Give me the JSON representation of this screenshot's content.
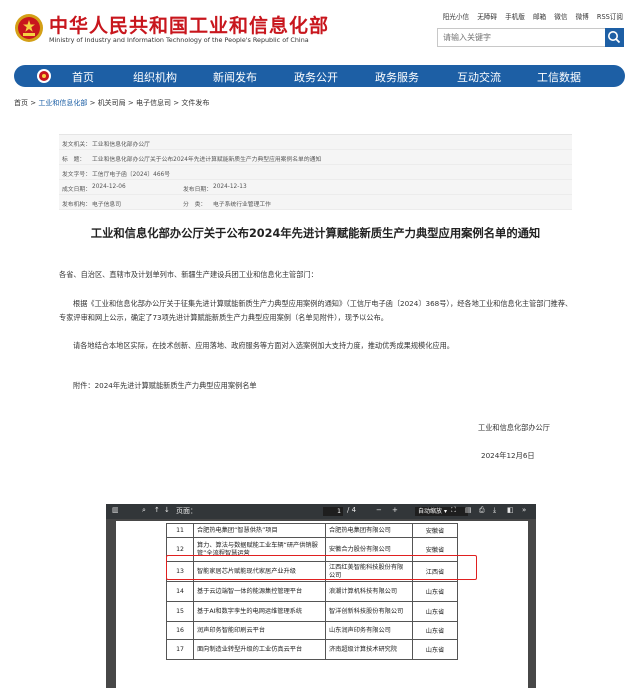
{
  "header": {
    "title": "中华人民共和国工业和信息化部",
    "subtitle": "Ministry of Industry and Information Technology of the People's Republic of China",
    "toplinks": [
      "阳光小信",
      "无障碍",
      "手机版",
      "邮箱",
      "微信",
      "微博",
      "RSS订阅"
    ],
    "search_placeholder": "请输入关键字",
    "brand_color": "#c8161d",
    "accent_color": "#1d5fa5"
  },
  "nav": {
    "items": [
      "首页",
      "组织机构",
      "新闻发布",
      "政务公开",
      "政务服务",
      "互动交流",
      "工信数据"
    ]
  },
  "breadcrumb": {
    "home": "首页",
    "sep": ">",
    "items": [
      "工业和信息化部",
      "机关司局",
      "电子信息司",
      "文件发布"
    ]
  },
  "meta": {
    "issuer_label": "发文机关：",
    "issuer": "工业和信息化部办公厅",
    "title_label": "标　题：",
    "title": "工业和信息化部办公厅关于公布2024年先进计算赋能新质生产力典型应用案例名单的通知",
    "docno_label": "发文字号：",
    "docno": "工信厅电子函〔2024〕466号",
    "created_label": "成文日期：",
    "created": "2024-12-06",
    "published_label": "发布日期：",
    "published": "2024-12-13",
    "org_label": "发布机构：",
    "org": "电子信息司",
    "category_label": "分　类：",
    "category": "电子系统行业管理工作"
  },
  "article": {
    "title": "工业和信息化部办公厅关于公布2024年先进计算赋能新质生产力典型应用案例名单的通知",
    "salutation": "各省、自治区、直辖市及计划单列市、新疆生产建设兵团工业和信息化主管部门：",
    "para1": "根据《工业和信息化部办公厅关于征集先进计算赋能新质生产力典型应用案例的通知》（工信厅电子函〔2024〕368号），经各地工业和信息化主管部门推荐、专家评审和网上公示，确定了73项先进计算赋能新质生产力典型应用案例（名单见附件），现予以公布。",
    "para2": "请各地结合本地区实际，在技术创新、应用落地、政府服务等方面对入选案例加大支持力度，推动优秀成果规模化应用。",
    "attachment": "附件：2024年先进计算赋能新质生产力典型应用案例名单",
    "signature": "工业和信息化部办公厅",
    "date": "2024年12月6日"
  },
  "pdf": {
    "page_label": "页面：",
    "page_current": "1",
    "page_total": "/ 4",
    "zoom": "自动缩放",
    "rows": [
      {
        "num": "11",
        "name": "合肥热电集团“智慧供热”项目",
        "org": "合肥热电集团有限公司",
        "prov": "安徽省"
      },
      {
        "num": "12",
        "name": "算力、算法与数据赋能工业车辆“研产供销服管”全流程智慧运营",
        "org": "安徽合力股份有限公司",
        "prov": "安徽省"
      },
      {
        "num": "13",
        "name": "智能家居芯片赋能现代家居产业升级",
        "org": "江西红美智能科技股份有限公司",
        "prov": "江西省"
      },
      {
        "num": "14",
        "name": "基于云边端智一体的能源集控管理平台",
        "org": "浪潮计算机科技有限公司",
        "prov": "山东省"
      },
      {
        "num": "15",
        "name": "基于AI和数字孪生的电网运维管理系统",
        "org": "智洋创新科技股份有限公司",
        "prov": "山东省"
      },
      {
        "num": "16",
        "name": "润声印务智能印刷云平台",
        "org": "山东润声印务有限公司",
        "prov": "山东省"
      },
      {
        "num": "17",
        "name": "面向制造业转型升级的工业仿真云平台",
        "org": "济南超级计算技术研究院",
        "prov": "山东省"
      }
    ]
  }
}
